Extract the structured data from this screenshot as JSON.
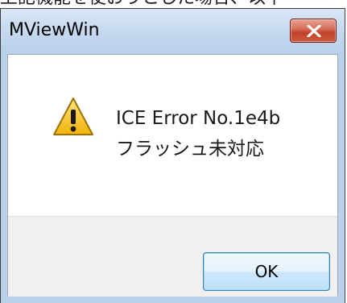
{
  "background_text": "上記機能を使おうとした場合、以下",
  "dialog": {
    "title": "MViewWin",
    "close_icon": "close-x-icon",
    "message_icon": "warning-icon",
    "message_lines": [
      "ICE Error No.1e4b",
      "フラッシュ未対応"
    ],
    "ok_label": "OK"
  },
  "colors": {
    "titlebar": "#c7daf0",
    "close_button": "#c1412a",
    "ok_button_border": "#3c7fb1",
    "button_panel": "#f0f0f0",
    "warning_yellow": "#f7c416"
  }
}
